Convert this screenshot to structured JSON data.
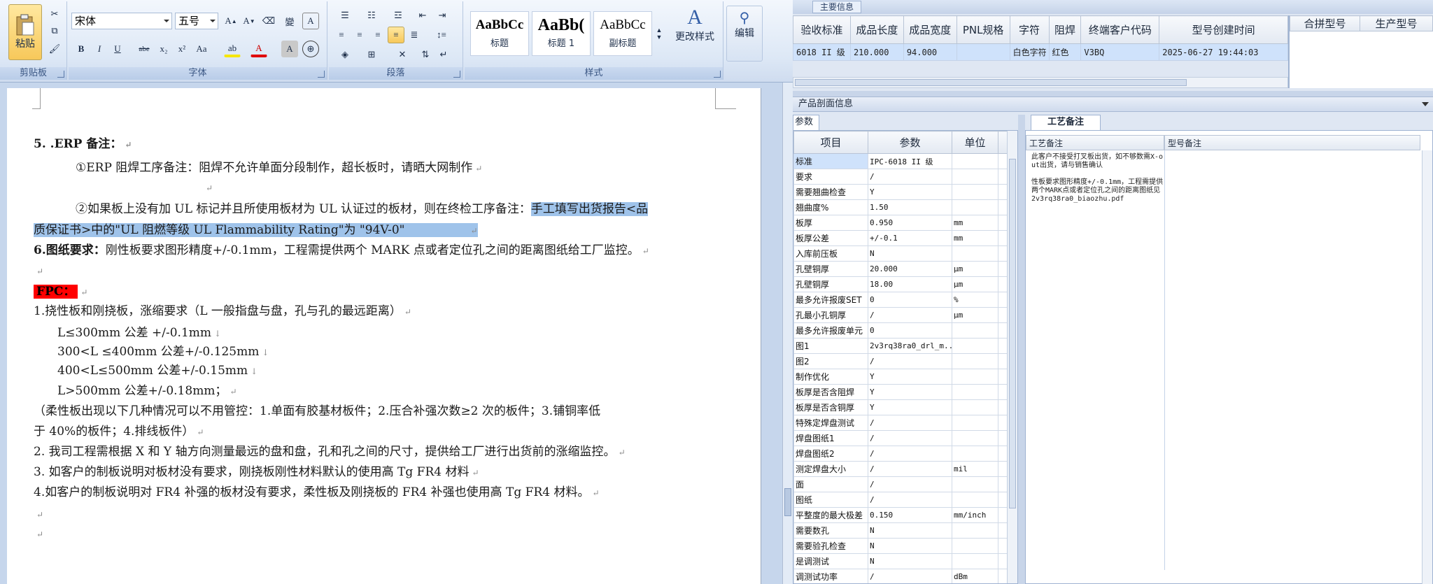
{
  "word": {
    "clipboard": {
      "paste_label": "粘贴",
      "group_label": "剪贴板"
    },
    "font": {
      "font_name": "宋体",
      "font_size": "五号",
      "group_label": "字体",
      "style_buttons": [
        "B",
        "I",
        "U",
        "abe",
        "x₂",
        "x²",
        "Aa"
      ]
    },
    "paragraph": {
      "group_label": "段落"
    },
    "styles": {
      "group_label": "样式",
      "items": [
        {
          "sample": "AaBbCc",
          "name": "标题"
        },
        {
          "sample": "AaBb(",
          "name": "标题 1"
        },
        {
          "sample": "AaBbCc",
          "name": "副标题"
        }
      ],
      "change_styles_label": "更改样式"
    },
    "editing": {
      "label": "编辑"
    },
    "doc": {
      "l1_num": "5. .ERP 备注：",
      "l2": "①ERP 阻焊工序备注：阻焊不允许单面分段制作，超长板时，请晒大网制作",
      "l3_plain": "②如果板上没有加 UL 标记并且所使用板材为 UL 认证过的板材，则在终检工序备注：",
      "l3_sel": "手工填写出货报告<品",
      "l4_sel": "质保证书>中的\"UL 阻燃等级 UL Flammability Rating\"为 \"94V-0\"",
      "l5_bold": "6.图纸要求：",
      "l5_rest": "刚性板要求图形精度+/-0.1mm，工程需提供两个 MARK 点或者定位孔之间的距离图纸给工厂监控。",
      "fpc": "FPC：",
      "l7": "1.挠性板和刚挠板，涨缩要求（L 一般指盘与盘，孔与孔的最远距离）",
      "l8": "L≤300mm 公差 +/-0.1mm",
      "l9": "300<L ≤400mm 公差+/-0.125mm",
      "l10": "400<L≤500mm 公差+/-0.15mm",
      "l11": "L>500mm 公差+/-0.18mm；",
      "l12": "（柔性板出现以下几种情况可以不用管控：1.单面有胶基材板件；2.压合补强次数≥2 次的板件；3.铺铜率低",
      "l13": "于 40%的板件；4.排线板件）",
      "l14": "2.    我司工程需根据 X 和 Y 轴方向测量最远的盘和盘，孔和孔之间的尺寸，提供给工厂进行出货前的涨缩监控。",
      "l15": "3. 如客户的制板说明对板材没有要求，刚挠板刚性材料默认的使用高 Tg FR4 材料",
      "l16": "4.如客户的制板说明对 FR4 补强的板材没有要求，柔性板及刚挠板的 FR4 补强也使用高 Tg FR4 材料。"
    }
  },
  "erp": {
    "top_tab": "主要信息",
    "grid1_headers": [
      "验收标准",
      "成品长度",
      "成品宽度",
      "PNL规格",
      "字符",
      "阻焊",
      "终端客户代码",
      "型号创建时间"
    ],
    "grid1_row": [
      "6018 II 级",
      "210.000",
      "94.000",
      "",
      "白色字符",
      "红色",
      "V3BQ",
      "2025-06-27 19:44:03"
    ],
    "grid2_headers": [
      "合拼型号",
      "生产型号"
    ],
    "section_title": "产品剖面信息",
    "params_tab": "参数",
    "params_headers": [
      "项目",
      "参数",
      "单位"
    ],
    "params_rows": [
      [
        "标准",
        "IPC-6018 II 级",
        ""
      ],
      [
        "要求",
        "/",
        ""
      ],
      [
        "需要翘曲检查",
        "Y",
        ""
      ],
      [
        "翘曲度%",
        "1.50",
        ""
      ],
      [
        "板厚",
        "0.950",
        "mm"
      ],
      [
        "板厚公差",
        "+/-0.1",
        "mm"
      ],
      [
        "入库前压板",
        "N",
        ""
      ],
      [
        "孔壁铜厚",
        "20.000",
        "μm"
      ],
      [
        "孔壁铜厚",
        "18.00",
        "μm"
      ],
      [
        "最多允许报废SET",
        "0",
        "%"
      ],
      [
        "孔最小孔铜厚",
        "/",
        "μm"
      ],
      [
        "最多允许报废单元",
        "0",
        ""
      ],
      [
        "图1",
        "2v3rq38ra0_drl_m...",
        ""
      ],
      [
        "图2",
        "/",
        ""
      ],
      [
        "制作优化",
        "Y",
        ""
      ],
      [
        "板厚是否含阻焊",
        "Y",
        ""
      ],
      [
        "板厚是否含铜厚",
        "Y",
        ""
      ],
      [
        "特殊定焊盘测试",
        "/",
        ""
      ],
      [
        "焊盘图纸1",
        "/",
        ""
      ],
      [
        "焊盘图纸2",
        "/",
        ""
      ],
      [
        "测定焊盘大小",
        "/",
        "mil"
      ],
      [
        "面",
        "/",
        ""
      ],
      [
        "图纸",
        "/",
        ""
      ],
      [
        "平整度的最大极差",
        "0.150",
        "mm/inch"
      ],
      [
        "需要数孔",
        "N",
        ""
      ],
      [
        "需要验孔检查",
        "N",
        ""
      ],
      [
        "是调测试",
        "N",
        ""
      ],
      [
        "调测试功率",
        "/",
        "dBm"
      ]
    ],
    "craft_tab": "工艺备注",
    "craft_col1": "工艺备注",
    "craft_col2": "型号备注",
    "craft_note": "此客户不接受打叉板出货，如不够数需X-out出货，请与销售确认\n\n性板要求图形精度+/-0.1mm，工程需提供两个MARK点或者定位孔之间的距离图纸见\n2v3rq38ra0_biaozhu.pdf"
  }
}
